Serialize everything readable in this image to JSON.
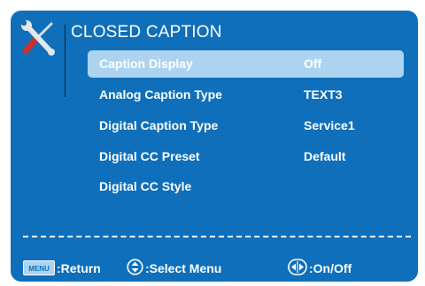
{
  "menu": {
    "title": "CLOSED CAPTION",
    "items": [
      {
        "label": "Caption Display",
        "value": "Off",
        "selected": true
      },
      {
        "label": "Analog Caption Type",
        "value": "TEXT3",
        "selected": false
      },
      {
        "label": "Digital Caption Type",
        "value": "Service1",
        "selected": false
      },
      {
        "label": "Digital CC Preset",
        "value": "Default",
        "selected": false
      },
      {
        "label": "Digital CC Style",
        "value": "",
        "selected": false
      }
    ]
  },
  "footer": {
    "menu_key": "MENU",
    "return_label": ":Return",
    "select_label": ":Select Menu",
    "onoff_label": ":On/Off"
  },
  "icons": {
    "settings": "wrench-screwdriver-icon",
    "updown": "up-down-arrows-icon",
    "leftright": "left-right-arrows-icon"
  },
  "colors": {
    "panel": "#0f6fba",
    "highlight": "#acd4f1",
    "text": "#ffffff"
  }
}
